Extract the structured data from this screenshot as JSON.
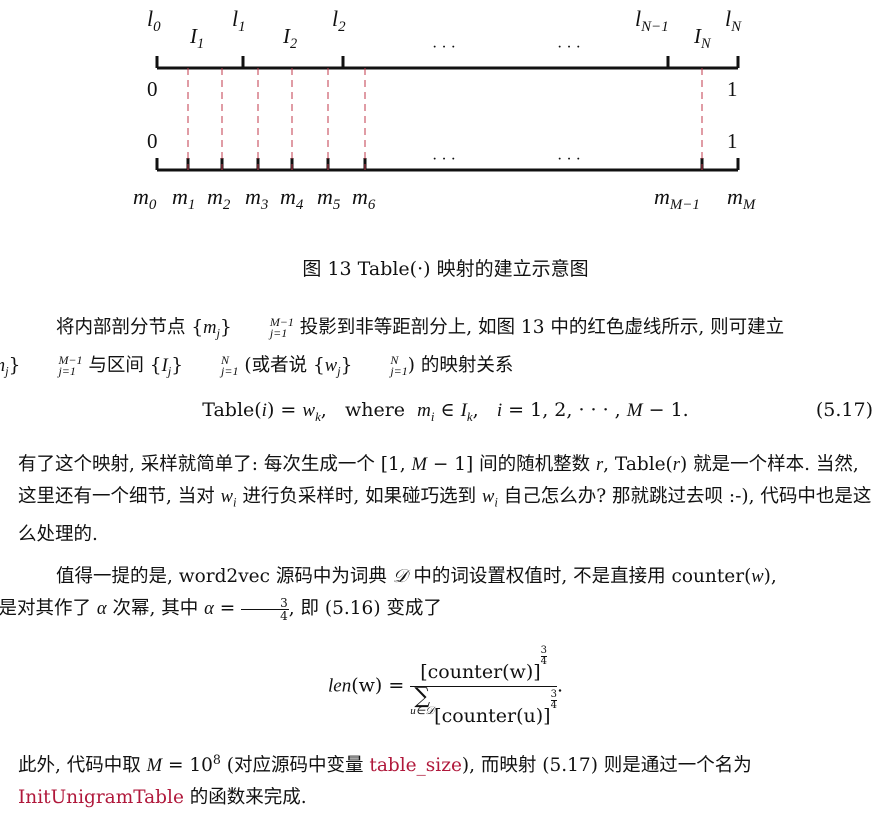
{
  "figure": {
    "top_labels": [
      "l",
      "l",
      "l",
      "l",
      "l"
    ],
    "top_label_subs": [
      "0",
      "1",
      "2",
      "N−1",
      "N"
    ],
    "interval_labels": [
      "I",
      "I",
      "I"
    ],
    "interval_label_subs": [
      "1",
      "2",
      "N"
    ],
    "ellipsis": "· · ·",
    "left_values": [
      "0",
      "0"
    ],
    "right_values": [
      "1",
      "1"
    ],
    "bottom_labels": [
      "m",
      "m",
      "m",
      "m",
      "m",
      "m",
      "m",
      "m",
      "m"
    ],
    "bottom_label_subs": [
      "0",
      "1",
      "2",
      "3",
      "4",
      "5",
      "6",
      "M−1",
      "M"
    ],
    "dash_color": "#c0394b"
  },
  "caption": "图 13   Table(·) 映射的建立示意图",
  "p1": {
    "t1": "将内部剖分节点 {",
    "m1": "m",
    "s1": "j",
    "t2": "}",
    "sup1": "M−1",
    "sub1": "j=1",
    "t3": " 投影到非等距剖分上, 如图 13 中的红色虚线所示, 则可建立",
    "t4": "{",
    "m2": "m",
    "s2": "j",
    "t5": "}",
    "sup2": "M−1",
    "sub2": "j=1",
    "t6": " 与区间 {",
    "m3": "I",
    "s3": "j",
    "t7": "}",
    "sup3": "N",
    "sub3": "j=1",
    "t8": " (或者说 {",
    "m4": "w",
    "s4": "j",
    "t9": "}",
    "sup4": "N",
    "sub4": "j=1",
    "t10": ") 的映射关系"
  },
  "eq1": {
    "lhs": "Table(",
    "i": "i",
    "mid": ") = ",
    "w": "w",
    "k": "k",
    "where": ",   where  ",
    "m": "m",
    "mi": "i",
    "in": " ∈ ",
    "I": "I",
    "Ik": "k",
    "rest": ",   ",
    "i2": "i",
    "range": " = 1, 2, · · · , ",
    "M": "M",
    "minus1": " − 1.",
    "num": "(5.17)"
  },
  "p2": {
    "t1": "有了这个映射, 采样就简单了: 每次生成一个 [1, ",
    "M": "M",
    "t2": " − 1] 间的随机整数 ",
    "r": "r",
    "t3": ", Table(",
    "r2": "r",
    "t4": ") 就是一个样本. 当然, 这里还有一个细节, 当对 ",
    "w1": "w",
    "i1": "i",
    "t5": " 进行负采样时, 如果碰巧选到 ",
    "w2": "w",
    "i2": "i",
    "t6": " 自己怎么办? 那就跳过去呗 :-), 代码中也是这么处理的."
  },
  "p3": {
    "t1": "值得一提的是, word2vec 源码中为词典 ",
    "D": "𝒟",
    "t2": " 中的词设置权值时, 不是直接用 counter(",
    "w": "w",
    "t3": "),",
    "t4": "而是对其作了 ",
    "alpha": "α",
    "t5": " 次幂, 其中 ",
    "alpha2": "α",
    "t6": " = ",
    "fn": "3",
    "fd": "4",
    "t7": ", 即 (5.16) 变成了"
  },
  "eq2": {
    "lhs": "len",
    "arg": "(w) = ",
    "num": "[counter(w)]",
    "sum": "∑",
    "sumsub": "u∈𝒟",
    "den": "[counter(u)]",
    "pn": "3",
    "pd": "4",
    "end": "."
  },
  "p4": {
    "t1": "此外, 代码中取 ",
    "M": "M",
    "t2": " = 10",
    "exp": "8",
    "t3": " (对应源码中变量 ",
    "var": "table_size",
    "t4": "), 而映射 (5.17) 则是通过一个名为",
    "fn": "InitUnigramTable",
    "t5": " 的函数来完成."
  }
}
